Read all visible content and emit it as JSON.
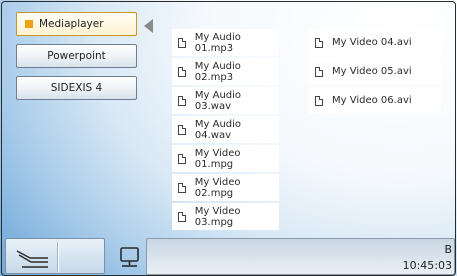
{
  "sidebar": {
    "items": [
      {
        "label": "Mediaplayer",
        "active": true
      },
      {
        "label": "Powerpoint",
        "active": false
      },
      {
        "label": "SIDEXIS 4",
        "active": false
      }
    ]
  },
  "files": {
    "column1": [
      "My Audio 01.mp3",
      "My Audio 02.mp3",
      "My Audio 03.wav",
      "My Audio 04.wav",
      "My Video 01.mpg",
      "My Video 02.mpg",
      "My Video 03.mpg"
    ],
    "column2": [
      "My Video 04.avi",
      "My Video 05.avi",
      "My Video 06.avi"
    ]
  },
  "bottombar": {
    "left_icon": "reclining-chair-icon",
    "right_icon": "monitor-icon"
  },
  "status": {
    "letter": "B",
    "time": "10:45:03"
  },
  "colors": {
    "accent": "#f2a21a",
    "background": "#7fb2de"
  }
}
